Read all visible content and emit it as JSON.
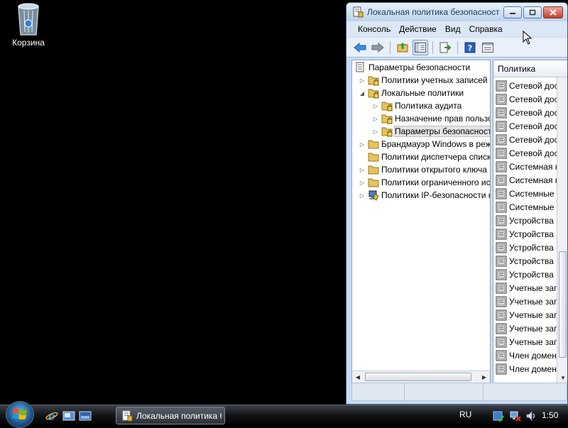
{
  "desktop": {
    "recycle_bin_label": "Корзина"
  },
  "window": {
    "title": "Локальная политика безопасности",
    "menu": [
      "Консоль",
      "Действие",
      "Вид",
      "Справка"
    ]
  },
  "tree": {
    "root": "Параметры безопасности",
    "items": [
      {
        "label": "Политики учетных записей",
        "expander": "▷",
        "icon": "folder-lock-icon",
        "level": 1
      },
      {
        "label": "Локальные политики",
        "expander": "◢",
        "icon": "folder-lock-icon",
        "level": 1
      },
      {
        "label": "Политика аудита",
        "expander": "▷",
        "icon": "folder-lock-icon",
        "level": 2
      },
      {
        "label": "Назначение прав пользователя",
        "expander": "▷",
        "icon": "folder-lock-icon",
        "level": 2
      },
      {
        "label": "Параметры безопасности",
        "expander": "▷",
        "icon": "folder-lock-icon",
        "level": 2,
        "selected": true
      },
      {
        "label": "Брандмауэр Windows в режиме повышенной безопасности",
        "expander": "▷",
        "icon": "folder-icon",
        "level": 1
      },
      {
        "label": "Политики диспетчера списка сетей",
        "expander": "",
        "icon": "folder-icon",
        "level": 1
      },
      {
        "label": "Политики открытого ключа",
        "expander": "▷",
        "icon": "folder-icon",
        "level": 1
      },
      {
        "label": "Политики ограниченного использования программ",
        "expander": "▷",
        "icon": "folder-icon",
        "level": 1
      },
      {
        "label": "Политики IP-безопасности на \"Локальный компьютер\"",
        "expander": "▷",
        "icon": "ip-security-icon",
        "level": 1
      }
    ]
  },
  "list": {
    "header": "Политика",
    "rows": [
      "Сетевой доступ",
      "Сетевой доступ",
      "Сетевой доступ",
      "Сетевой доступ",
      "Сетевой доступ",
      "Сетевой доступ",
      "Системная криптография",
      "Системная криптография",
      "Системные объекты",
      "Системные объекты",
      "Устройства",
      "Устройства",
      "Устройства",
      "Устройства",
      "Устройства",
      "Учетные записи",
      "Учетные записи",
      "Учетные записи",
      "Учетные записи",
      "Учетные записи",
      "Член домена",
      "Член домена"
    ]
  },
  "taskbar": {
    "active_task": "Локальная политика безопасности",
    "language": "RU",
    "clock": "1:50"
  },
  "colors": {
    "desktop": "#000000",
    "window_frame": "#c9dcf0",
    "close_button": "#c3422d",
    "selection": "#e3e3e3"
  }
}
